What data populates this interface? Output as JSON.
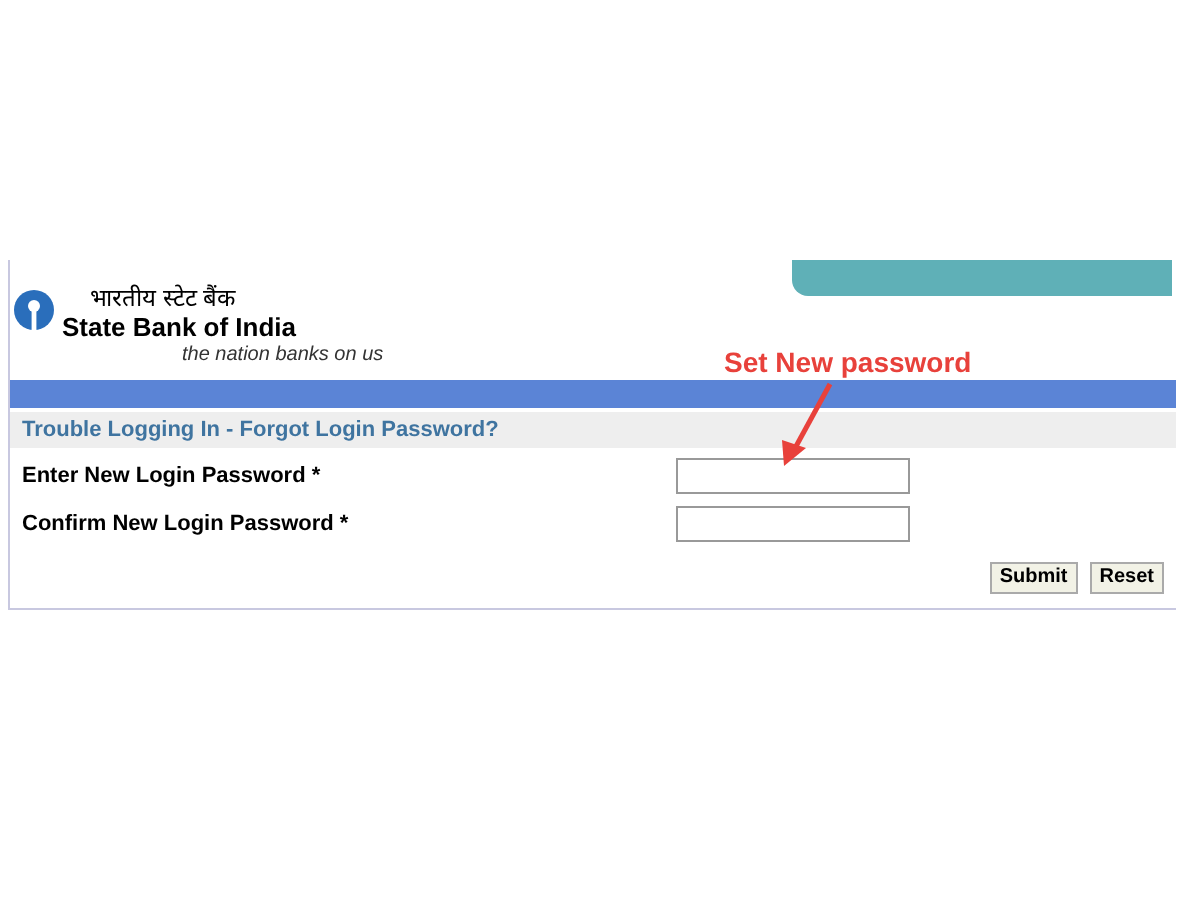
{
  "header": {
    "hindi_name": "भारतीय स्टेट बैंक",
    "bank_name": "State Bank of India",
    "tagline": "the nation banks on us"
  },
  "annotation": {
    "text": "Set New password"
  },
  "form": {
    "title": "Trouble Logging In - Forgot Login Password?",
    "fields": [
      {
        "label": "Enter New Login Password *"
      },
      {
        "label": "Confirm New Login Password *"
      }
    ],
    "buttons": [
      "Submit",
      "Reset"
    ]
  }
}
